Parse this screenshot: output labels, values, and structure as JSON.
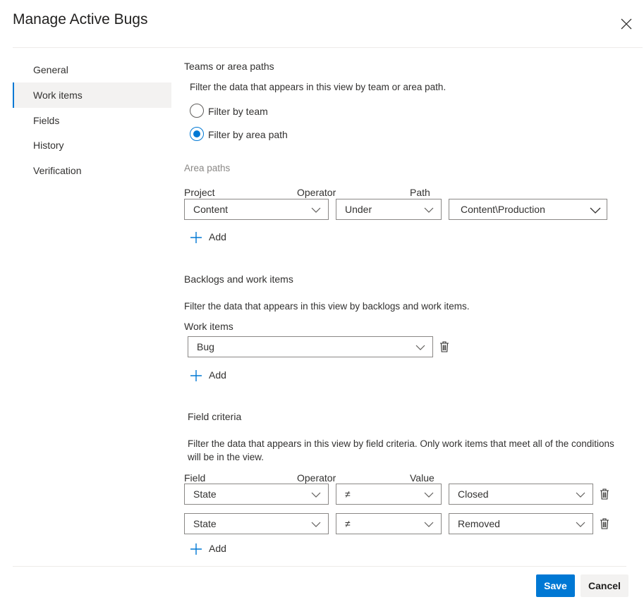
{
  "dialog": {
    "title": "Manage Active Bugs"
  },
  "nav": {
    "items": [
      {
        "label": "General"
      },
      {
        "label": "Work items"
      },
      {
        "label": "Fields"
      },
      {
        "label": "History"
      },
      {
        "label": "Verification"
      }
    ],
    "active": "Work items"
  },
  "teams": {
    "title": "Teams or area paths",
    "description": "Filter the data that appears in this view by team or area path.",
    "options": [
      {
        "label": "Filter by team",
        "selected": false
      },
      {
        "label": "Filter by area path",
        "selected": true
      }
    ]
  },
  "area_paths": {
    "label": "Area paths",
    "columns": {
      "project": "Project",
      "operator": "Operator",
      "path": "Path"
    },
    "row": {
      "project": "Content",
      "operator": "Under",
      "path": "Content\\Production"
    },
    "add_label": "Add"
  },
  "backlogs": {
    "title": "Backlogs and work items",
    "description": "Filter the data that appears in this view by backlogs and work items.",
    "work_items_label": "Work items",
    "work_item": "Bug",
    "add_label": "Add"
  },
  "field_criteria": {
    "title": "Field criteria",
    "description_line1": "Filter the data that appears in this view by field criteria. Only work items that meet all of the conditions",
    "description_line2": "will be in the view.",
    "columns": {
      "field": "Field",
      "operator": "Operator",
      "value": "Value"
    },
    "rows": [
      {
        "field": "State",
        "operator": "≠",
        "value": "Closed"
      },
      {
        "field": "State",
        "operator": "≠",
        "value": "Removed"
      }
    ],
    "add_label": "Add"
  },
  "footer": {
    "save_label": "Save",
    "cancel_label": "Cancel"
  },
  "colors": {
    "accent": "#0078d4",
    "border": "#8a8886",
    "nav_active_bg": "#f3f2f1"
  },
  "icons": {
    "close": "close-icon",
    "chevron": "chevron-down-icon",
    "plus": "plus-icon",
    "trash": "trash-icon"
  }
}
